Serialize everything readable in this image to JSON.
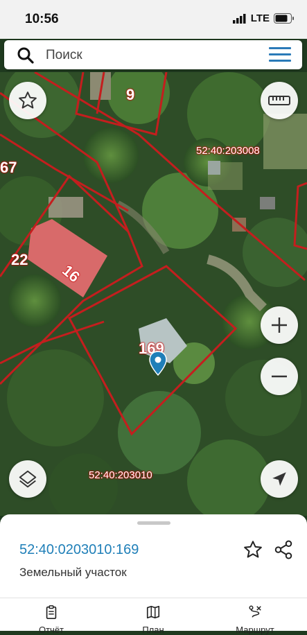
{
  "status_bar": {
    "time": "10:56",
    "network": "LTE"
  },
  "search": {
    "placeholder": "Поиск"
  },
  "map": {
    "plot_labels": [
      "9",
      "67",
      "22",
      "16",
      "169"
    ],
    "cadastral_quarters": [
      "52:40:203008",
      "52:40:203010"
    ]
  },
  "parcel": {
    "cadastral_number": "52:40:0203010:169",
    "type": "Земельный участок"
  },
  "tabs": [
    {
      "label": "Отчёт",
      "icon": "report-icon"
    },
    {
      "label": "План",
      "icon": "map-plan-icon"
    },
    {
      "label": "Маршрут",
      "icon": "route-icon"
    }
  ],
  "colors": {
    "accent": "#1f7fb8",
    "boundary": "#c41e1e",
    "menu": "#2a7ab8"
  }
}
